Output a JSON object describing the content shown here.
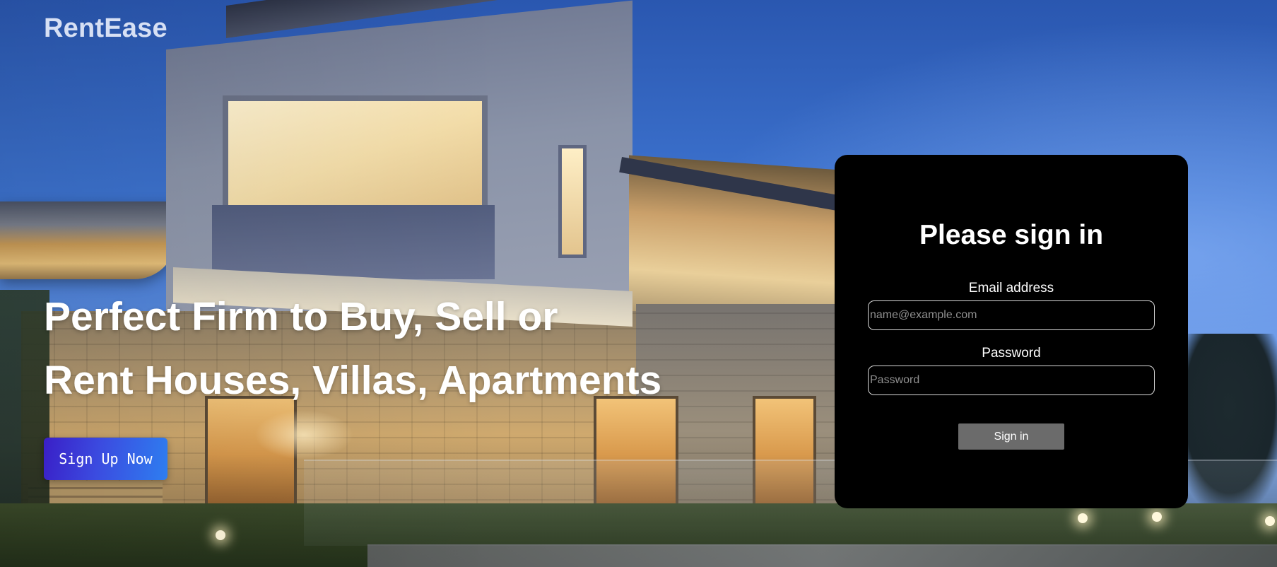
{
  "brand": {
    "name": "RentEase"
  },
  "hero": {
    "headline_line1": "Perfect Firm to Buy, Sell or",
    "headline_line2": "Rent Houses, Villas, Apartments",
    "cta_label": "Sign Up Now"
  },
  "signin": {
    "title": "Please sign in",
    "email_label": "Email address",
    "email_placeholder": "name@example.com",
    "email_value": "",
    "password_label": "Password",
    "password_placeholder": "Password",
    "password_value": "",
    "submit_label": "Sign in"
  },
  "colors": {
    "card_background": "#000000",
    "cta_gradient_start": "#3a1fc7",
    "cta_gradient_end": "#2e7ef0",
    "submit_button": "#6b6b6b"
  }
}
